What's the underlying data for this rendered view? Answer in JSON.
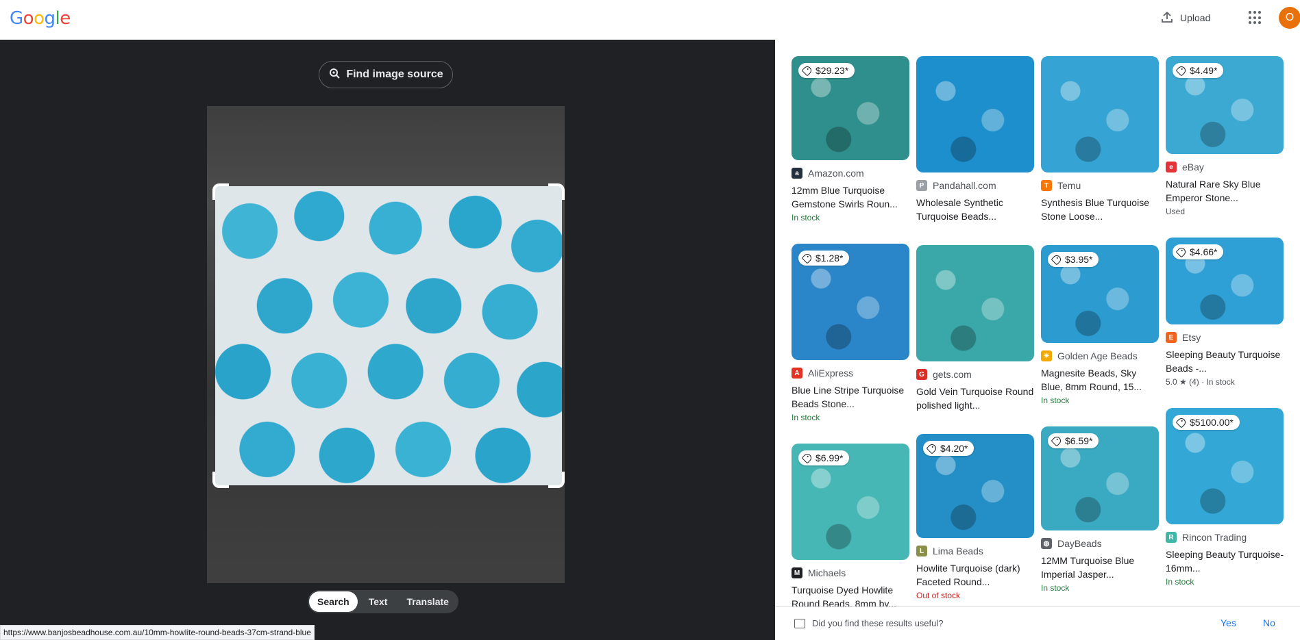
{
  "header": {
    "logo_letters": [
      "G",
      "o",
      "o",
      "g",
      "l",
      "e"
    ],
    "logo_colors": [
      "#4285F4",
      "#EA4335",
      "#FBBC05",
      "#4285F4",
      "#34A853",
      "#EA4335"
    ],
    "upload_label": "Upload",
    "avatar_letter": "O",
    "avatar_color": "#e8710a"
  },
  "lens": {
    "find_source_label": "Find image source",
    "modes": [
      "Search",
      "Text",
      "Translate"
    ],
    "active_mode": "Search"
  },
  "status_url": "https://www.banjosbeadhouse.com.au/10mm-howlite-round-beads-37cm-strand-blue",
  "results": [
    {
      "col": 0,
      "price": "$29.23*",
      "source": "Amazon.com",
      "favicon": "a",
      "favicon_color": "#232f3e",
      "title": "12mm Blue Turquoise Gemstone Swirls Roun...",
      "meta": "In stock",
      "meta_type": "instock",
      "thumb_color": "#2f8f8c"
    },
    {
      "col": 0,
      "price": "$1.28*",
      "source": "AliExpress",
      "favicon": "A",
      "favicon_color": "#e43225",
      "title": "Blue Line Stripe Turquoise Beads Stone...",
      "meta": "In stock",
      "meta_type": "instock",
      "thumb_color": "#2a86c8"
    },
    {
      "col": 0,
      "price": "$6.99*",
      "source": "Michaels",
      "favicon": "M",
      "favicon_color": "#202124",
      "title": "Turquoise Dyed Howlite Round Beads, 8mm by...",
      "meta": "",
      "meta_type": "",
      "thumb_color": "#46b7b5"
    },
    {
      "col": 1,
      "price": "",
      "source": "Pandahall.com",
      "favicon": "P",
      "favicon_color": "#9aa0a6",
      "title": "Wholesale Synthetic Turquoise Beads...",
      "meta": "",
      "meta_type": "",
      "thumb_color": "#1d8fcc"
    },
    {
      "col": 1,
      "price": "",
      "source": "gets.com",
      "favicon": "G",
      "favicon_color": "#d93025",
      "title": "Gold Vein Turquoise Round polished light...",
      "meta": "",
      "meta_type": "",
      "thumb_color": "#3aa7a8"
    },
    {
      "col": 1,
      "price": "$4.20*",
      "source": "Lima Beads",
      "favicon": "L",
      "favicon_color": "#8a8f4a",
      "title": "Howlite Turquoise (dark) Faceted Round...",
      "meta": "Out of stock",
      "meta_type": "oos",
      "thumb_color": "#248fc6"
    },
    {
      "col": 2,
      "price": "",
      "source": "Temu",
      "favicon": "T",
      "favicon_color": "#fb7701",
      "title": "Synthesis Blue Turquoise Stone Loose...",
      "meta": "",
      "meta_type": "",
      "thumb_color": "#35a3d3"
    },
    {
      "col": 2,
      "price": "$3.95*",
      "source": "Golden Age Beads",
      "favicon": "☀",
      "favicon_color": "#f2a900",
      "title": "Magnesite Beads, Sky Blue, 8mm Round, 15...",
      "meta": "In stock",
      "meta_type": "instock",
      "thumb_color": "#2b9bd0"
    },
    {
      "col": 2,
      "price": "$6.59*",
      "source": "DayBeads",
      "favicon": "◍",
      "favicon_color": "#5f6368",
      "title": "12MM Turquoise Blue Imperial Jasper...",
      "meta": "In stock",
      "meta_type": "instock",
      "thumb_color": "#3aa9c2"
    },
    {
      "col": 3,
      "price": "$4.49*",
      "source": "eBay",
      "favicon": "e",
      "favicon_color": "#e53238",
      "title": "Natural Rare Sky Blue Emperor Stone...",
      "meta": "Used",
      "meta_type": "used",
      "thumb_color": "#3ca9d2"
    },
    {
      "col": 3,
      "price": "$4.66*",
      "source": "Etsy",
      "favicon": "E",
      "favicon_color": "#f1641e",
      "title": "Sleeping Beauty Turquoise Beads -...",
      "meta": "5.0 ★ (4) · In stock",
      "meta_type": "rating",
      "thumb_color": "#2fa0d6"
    },
    {
      "col": 3,
      "price": "$5100.00*",
      "source": "Rincon Trading",
      "favicon": "R",
      "favicon_color": "#3fb6a8",
      "title": "Sleeping Beauty Turquoise- 16mm...",
      "meta": "In stock",
      "meta_type": "instock",
      "thumb_color": "#33a8d6"
    }
  ],
  "feedback": {
    "question": "Did you find these results useful?",
    "yes_label": "Yes",
    "no_label": "No"
  }
}
